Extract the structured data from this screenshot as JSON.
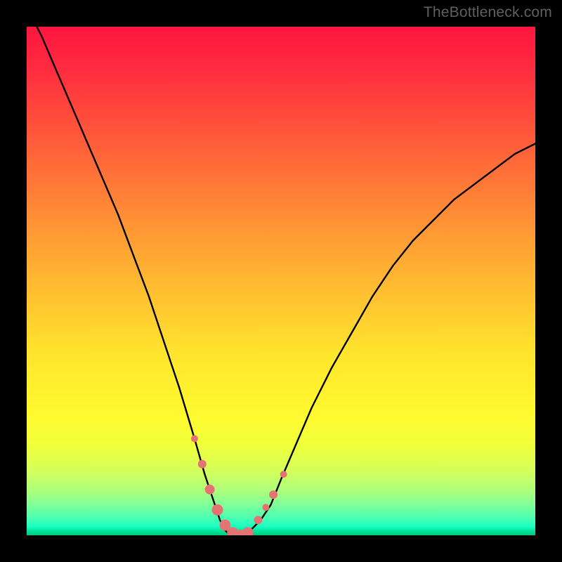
{
  "watermark": "TheBottleneck.com",
  "chart_data": {
    "type": "line",
    "title": "",
    "xlabel": "",
    "ylabel": "",
    "xlim": [
      0,
      100
    ],
    "ylim": [
      0,
      100
    ],
    "grid": false,
    "background_gradient": {
      "stops": [
        {
          "pos": 0,
          "color": "#ff153f"
        },
        {
          "pos": 0.36,
          "color": "#ff8a36"
        },
        {
          "pos": 0.64,
          "color": "#ffe42d"
        },
        {
          "pos": 0.88,
          "color": "#d6ff59"
        },
        {
          "pos": 1.0,
          "color": "#00c87f"
        }
      ]
    },
    "series": [
      {
        "name": "bottleneck-curve",
        "color": "#000000",
        "x": [
          0,
          3,
          6,
          9,
          12,
          15,
          18,
          21,
          24,
          27,
          30,
          33,
          35,
          37,
          38,
          39,
          40,
          42,
          44,
          46,
          48,
          50,
          53,
          56,
          60,
          64,
          68,
          72,
          76,
          80,
          84,
          88,
          92,
          96,
          100
        ],
        "y": [
          104,
          98,
          91,
          84,
          77,
          70,
          63,
          55,
          47,
          38,
          29,
          19,
          12,
          6,
          3,
          1,
          0,
          0,
          1,
          3,
          6,
          11,
          18,
          25,
          33,
          40,
          47,
          53,
          58,
          62,
          66,
          69,
          72,
          75,
          77
        ]
      }
    ],
    "markers": {
      "name": "highlight-dots",
      "color": "#e57373",
      "points": [
        {
          "x": 33.0,
          "y": 19.0,
          "r": 5
        },
        {
          "x": 34.5,
          "y": 14.0,
          "r": 6
        },
        {
          "x": 36.0,
          "y": 9.0,
          "r": 7
        },
        {
          "x": 37.5,
          "y": 5.0,
          "r": 8
        },
        {
          "x": 39.0,
          "y": 2.0,
          "r": 8
        },
        {
          "x": 40.5,
          "y": 0.5,
          "r": 8
        },
        {
          "x": 42.0,
          "y": 0.0,
          "r": 8
        },
        {
          "x": 43.5,
          "y": 0.5,
          "r": 8
        },
        {
          "x": 45.5,
          "y": 3.0,
          "r": 6
        },
        {
          "x": 47.0,
          "y": 5.5,
          "r": 5
        },
        {
          "x": 48.5,
          "y": 8.0,
          "r": 6
        },
        {
          "x": 50.5,
          "y": 12.0,
          "r": 5
        }
      ]
    }
  }
}
